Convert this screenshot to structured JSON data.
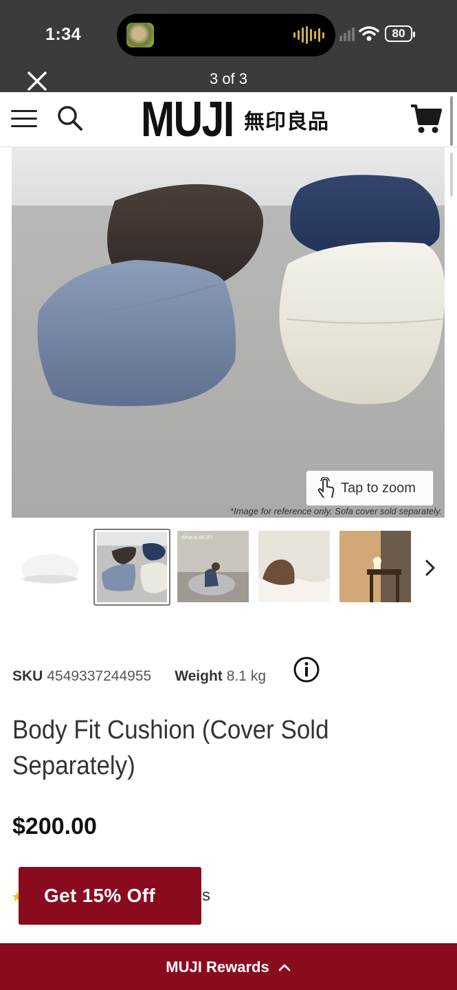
{
  "status_bar": {
    "time": "1:34",
    "battery": "80"
  },
  "viewer": {
    "title": "3 of 3",
    "close_icon": "close-icon"
  },
  "header": {
    "logo_latin": "MUJI",
    "logo_jp": "無印良品",
    "icons": [
      "menu-icon",
      "search-icon",
      "cart-icon"
    ]
  },
  "main_image": {
    "zoom_label": "Tap to zoom",
    "disclaimer": "*Image for reference only. Sofa cover sold separately."
  },
  "thumbnails": {
    "count": 5,
    "selected_index": 1,
    "thumb3_caption": "What is MUJI?"
  },
  "product": {
    "sku_label": "SKU",
    "sku": "4549337244955",
    "weight_label": "Weight",
    "weight": "8.1 kg",
    "title": "Body Fit Cushion (Cover Sold Separately)",
    "price": "$200.00",
    "reviews_tail": "s"
  },
  "promo": {
    "label": "Get 15% Off"
  },
  "rewards": {
    "label": "MUJI Rewards"
  },
  "colors": {
    "brand_red": "#8b0b1e",
    "topbar": "#3a3b3d"
  }
}
